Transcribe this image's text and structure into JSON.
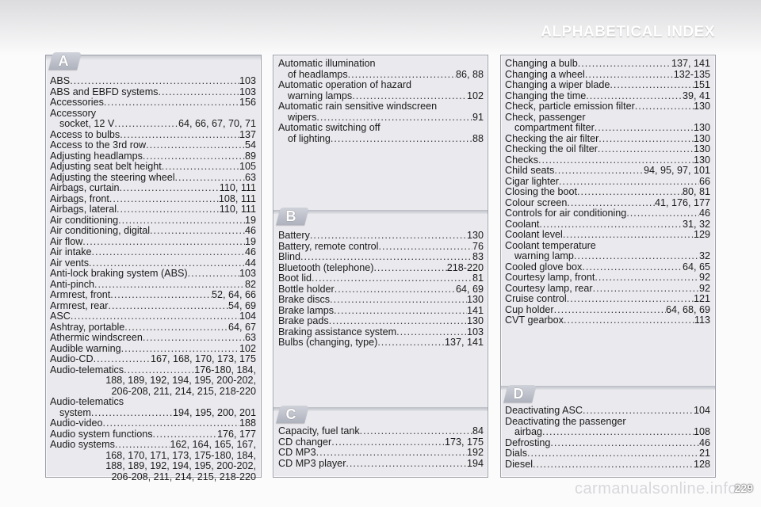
{
  "header": {
    "title": "ALPHABETICAL INDEX",
    "page_number": "229"
  },
  "watermark": "carmanualsonline.info",
  "sections": {
    "A": {
      "letter": "A",
      "entries": [
        {
          "label": "ABS",
          "pages": "103"
        },
        {
          "label": "ABS and EBFD systems",
          "pages": "103"
        },
        {
          "label": "Accessories",
          "pages": "156"
        },
        {
          "label": "Accessory",
          "pages": ""
        },
        {
          "label": "socket, 12 V",
          "pages": "64, 66, 67, 70, 71"
        },
        {
          "label": "Access to bulbs",
          "pages": "137"
        },
        {
          "label": "Access to the 3rd row",
          "pages": "54"
        },
        {
          "label": "Adjusting headlamps",
          "pages": "89"
        },
        {
          "label": "Adjusting seat belt height",
          "pages": "105"
        },
        {
          "label": "Adjusting the steering wheel",
          "pages": "63"
        },
        {
          "label": "Airbags, curtain",
          "pages": "110, 111"
        },
        {
          "label": "Airbags, front",
          "pages": "108, 111"
        },
        {
          "label": "Airbags, lateral",
          "pages": "110, 111"
        },
        {
          "label": "Air conditioning",
          "pages": "19"
        },
        {
          "label": "Air conditioning, digital",
          "pages": "46"
        },
        {
          "label": "Air flow",
          "pages": "19"
        },
        {
          "label": "Air intake",
          "pages": "46"
        },
        {
          "label": "Air vents",
          "pages": "44"
        },
        {
          "label": "Anti-lock braking system (ABS)",
          "pages": "103"
        },
        {
          "label": "Anti-pinch",
          "pages": "82"
        },
        {
          "label": "Armrest, front",
          "pages": "52, 64, 66"
        },
        {
          "label": "Armrest, rear",
          "pages": "54, 69"
        },
        {
          "label": "ASC",
          "pages": "104"
        },
        {
          "label": "Ashtray, portable",
          "pages": "64, 67"
        },
        {
          "label": "Athermic windscreen",
          "pages": "63"
        },
        {
          "label": "Audible warning",
          "pages": "102"
        },
        {
          "label": "Audio-CD",
          "pages": "167, 168, 170, 173, 175"
        },
        {
          "label": "Audio-telematics",
          "pages": "176-180, 184,"
        },
        {
          "label": "188, 189, 192, 194, 195, 200-202,",
          "pages": ""
        },
        {
          "label": "206-208, 211, 214, 215, 218-220",
          "pages": ""
        },
        {
          "label": "Audio-telematics",
          "pages": ""
        },
        {
          "label": "system",
          "pages": "194, 195, 200, 201"
        },
        {
          "label": "Audio-video",
          "pages": "188"
        },
        {
          "label": "Audio system functions",
          "pages": "176, 177"
        },
        {
          "label": "Audio systems",
          "pages": "162, 164, 165, 167,"
        },
        {
          "label": "168, 170, 171, 173, 175-180, 184,",
          "pages": ""
        },
        {
          "label": "188, 189, 192, 194, 195, 200-202,",
          "pages": ""
        },
        {
          "label": "206-208, 211, 214, 215, 218-220",
          "pages": ""
        }
      ]
    },
    "automatic": {
      "entries": [
        {
          "label": "Automatic illumination",
          "pages": ""
        },
        {
          "label": "of headlamps",
          "pages": "86, 88"
        },
        {
          "label": "Automatic operation of hazard",
          "pages": ""
        },
        {
          "label": "warning lamps",
          "pages": "102"
        },
        {
          "label": "Automatic rain sensitive windscreen",
          "pages": ""
        },
        {
          "label": "wipers",
          "pages": "91"
        },
        {
          "label": "Automatic switching off",
          "pages": ""
        },
        {
          "label": "of lighting",
          "pages": "88"
        }
      ]
    },
    "B": {
      "letter": "B",
      "entries": [
        {
          "label": "Battery",
          "pages": "130"
        },
        {
          "label": "Battery, remote control",
          "pages": "76"
        },
        {
          "label": "Blind",
          "pages": "83"
        },
        {
          "label": "Bluetooth (telephone)",
          "pages": "218-220"
        },
        {
          "label": "Boot lid",
          "pages": "81"
        },
        {
          "label": "Bottle holder",
          "pages": "64, 69"
        },
        {
          "label": "Brake discs",
          "pages": "130"
        },
        {
          "label": "Brake lamps",
          "pages": "141"
        },
        {
          "label": "Brake pads",
          "pages": "130"
        },
        {
          "label": "Braking assistance system",
          "pages": "103"
        },
        {
          "label": "Bulbs (changing, type)",
          "pages": "137, 141"
        }
      ]
    },
    "C": {
      "letter": "C",
      "entries": [
        {
          "label": "Capacity, fuel tank",
          "pages": "84"
        },
        {
          "label": "CD changer",
          "pages": "173, 175"
        },
        {
          "label": "CD MP3",
          "pages": "192"
        },
        {
          "label": "CD MP3 player",
          "pages": "194"
        }
      ]
    },
    "C_cont": {
      "entries": [
        {
          "label": "Changing a bulb",
          "pages": "137, 141"
        },
        {
          "label": "Changing a wheel",
          "pages": "132-135"
        },
        {
          "label": "Changing a wiper blade",
          "pages": "151"
        },
        {
          "label": "Changing the time",
          "pages": "39, 41"
        },
        {
          "label": "Check, particle emission filter",
          "pages": "130"
        },
        {
          "label": "Check, passenger",
          "pages": ""
        },
        {
          "label": "compartment filter",
          "pages": "130"
        },
        {
          "label": "Checking the air filter",
          "pages": "130"
        },
        {
          "label": "Checking the oil filter",
          "pages": "130"
        },
        {
          "label": "Checks",
          "pages": "130"
        },
        {
          "label": "Child seats",
          "pages": "94, 95, 97, 101"
        },
        {
          "label": "Cigar lighter",
          "pages": "66"
        },
        {
          "label": "Closing the boot",
          "pages": "80, 81"
        },
        {
          "label": "Colour screen",
          "pages": "41, 176, 177"
        },
        {
          "label": "Controls for air conditioning",
          "pages": "46"
        },
        {
          "label": "Coolant",
          "pages": "31, 32"
        },
        {
          "label": "Coolant level",
          "pages": "129"
        },
        {
          "label": "Coolant temperature",
          "pages": ""
        },
        {
          "label": "warning lamp",
          "pages": "32"
        },
        {
          "label": "Cooled glove box",
          "pages": "64, 65"
        },
        {
          "label": "Courtesy lamp, front",
          "pages": "92"
        },
        {
          "label": "Courtesy lamp, rear",
          "pages": "92"
        },
        {
          "label": "Cruise control",
          "pages": "121"
        },
        {
          "label": "Cup holder",
          "pages": "64, 68, 69"
        },
        {
          "label": "CVT gearbox",
          "pages": "113"
        }
      ]
    },
    "D": {
      "letter": "D",
      "entries": [
        {
          "label": "Deactivating ASC",
          "pages": "104"
        },
        {
          "label": "Deactivating the passenger",
          "pages": ""
        },
        {
          "label": "airbag",
          "pages": "108"
        },
        {
          "label": "Defrosting",
          "pages": "46"
        },
        {
          "label": "Dials",
          "pages": "21"
        },
        {
          "label": "Diesel",
          "pages": "128"
        }
      ]
    }
  }
}
